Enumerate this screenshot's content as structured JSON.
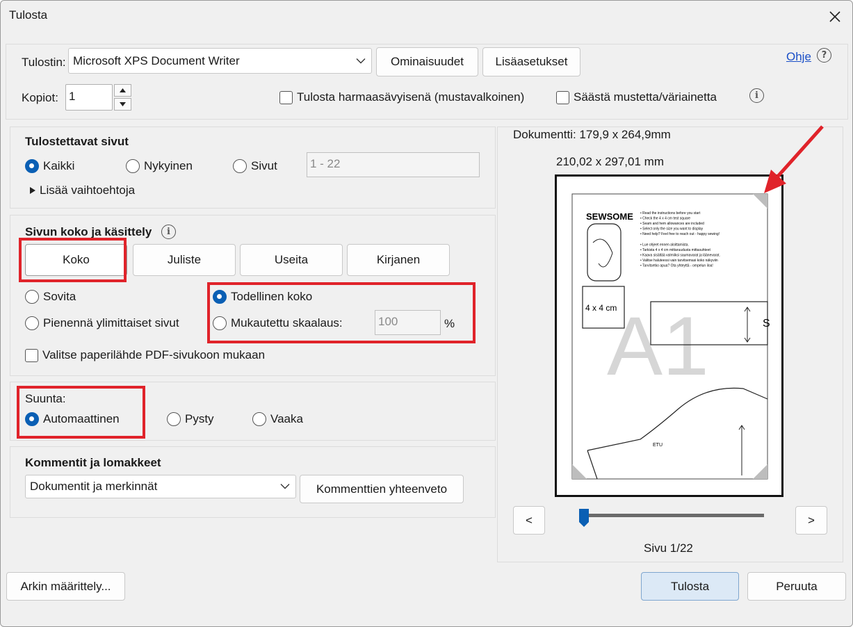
{
  "window": {
    "title": "Tulosta"
  },
  "printer": {
    "label": "Tulostin:",
    "selected": "Microsoft XPS Document Writer",
    "properties_button": "Ominaisuudet",
    "advanced_button": "Lisäasetukset",
    "help_link": "Ohje"
  },
  "copies": {
    "label": "Kopiot:",
    "value": "1",
    "grayscale_label": "Tulosta harmaasävyisenä (mustavalkoinen)",
    "save_ink_label": "Säästä mustetta/väriainetta"
  },
  "pages_section": {
    "heading": "Tulostettavat sivut",
    "options": [
      "Kaikki",
      "Nykyinen",
      "Sivut"
    ],
    "selected": "Kaikki",
    "range_placeholder": "1 - 22",
    "more_options": "Lisää vaihtoehtoja"
  },
  "sizing_section": {
    "heading": "Sivun koko ja käsittely",
    "tabs": [
      "Koko",
      "Juliste",
      "Useita",
      "Kirjanen"
    ],
    "fit_label": "Sovita",
    "shrink_label": "Pienennä ylimittaiset sivut",
    "actual_label": "Todellinen koko",
    "custom_label": "Mukautettu skaalaus:",
    "custom_value": "100",
    "percent": "%",
    "paper_source_label": "Valitse paperilähde PDF-sivukoon mukaan",
    "selected": "Todellinen koko"
  },
  "orientation": {
    "label": "Suunta:",
    "options": [
      "Automaattinen",
      "Pysty",
      "Vaaka"
    ],
    "selected": "Automaattinen"
  },
  "comments": {
    "heading": "Kommentit ja lomakkeet",
    "selected": "Dokumentit ja merkinnät",
    "summary_button": "Kommenttien yhteenveto"
  },
  "preview": {
    "document_size": "Dokumentti: 179,9 x 264,9mm",
    "paper_size": "210,02 x 297,01 mm",
    "page_indicator": "Sivu 1/22",
    "page_fraction": 0.0,
    "prev_label": "<",
    "next_label": ">",
    "content": {
      "brand": "SEWSOME",
      "bullets": [
        "Read the instructions before you start",
        "Check the 4 x 4 cm test square",
        "Seam and hem allowances are included",
        "Select only the size you want to display",
        "Need help? Feel free to reach out - happy sewing!",
        "Lue ohjeet ennen aloittamista.",
        "Tarkista 4 x 4 cm mittaruudusta mittasuhteet",
        "Kaava sisältää valmiiksi saumavarat ja läänevarat.",
        "Valitse haluteessi vain tarvitsemasi koko näkyviin",
        "Tarvitsetko apua? Ota yhteyttä - ompelun iloa!"
      ],
      "test_square": "4 x 4 cm",
      "watermark": "A1",
      "size_mark": "S",
      "etu_label": "ETU"
    }
  },
  "footer": {
    "page_setup_button": "Arkin määrittely...",
    "print_button": "Tulosta",
    "cancel_button": "Peruuta"
  },
  "colors": {
    "annotation": "#e0232a",
    "accent": "#0a5fb4",
    "primary_button": "#dce9f6"
  }
}
